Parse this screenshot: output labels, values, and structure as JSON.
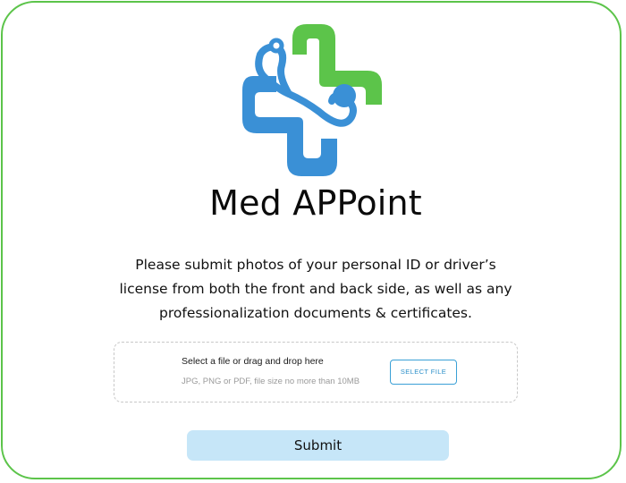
{
  "app": {
    "title": "Med APPoint"
  },
  "instructions": {
    "line1": "Please submit photos of your personal ID or driver’s",
    "line2": "license from both the front and back side, as well as any",
    "line3": "professionalization documents & certificates."
  },
  "upload": {
    "primary_text": "Select a file or drag and drop here",
    "secondary_text": "JPG, PNG or PDF, file size no more than 10MB",
    "button_label": "SELECT FILE"
  },
  "submit": {
    "label": "Submit"
  },
  "colors": {
    "brand_green": "#5cc44a",
    "brand_blue": "#3a90d6",
    "submit_bg": "#c6e6f8",
    "select_file_accent": "#3aa0d6"
  },
  "icons": {
    "logo": "medical-cross-stethoscope-logo"
  }
}
